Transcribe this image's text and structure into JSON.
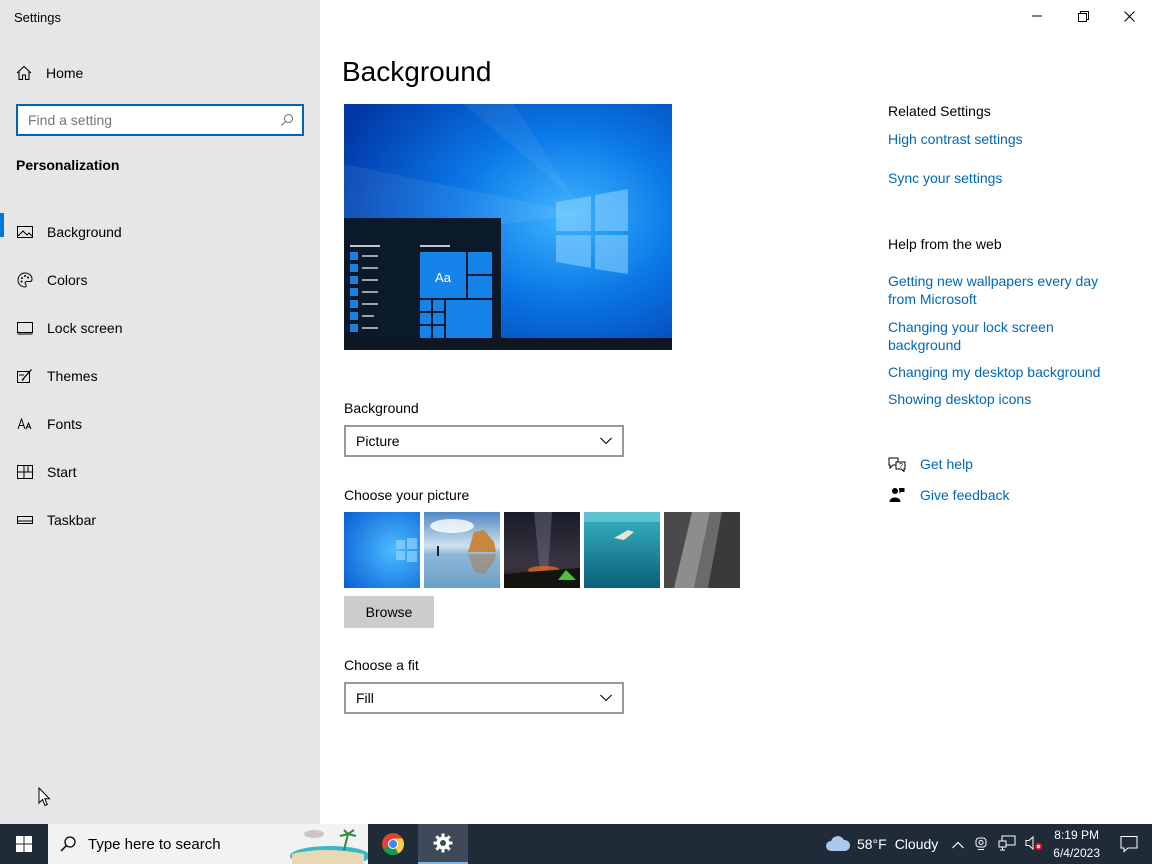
{
  "window": {
    "title": "Settings"
  },
  "sidebar": {
    "home_label": "Home",
    "search_placeholder": "Find a setting",
    "section_title": "Personalization",
    "items": [
      {
        "label": "Background",
        "icon": "picture-icon",
        "active": true
      },
      {
        "label": "Colors",
        "icon": "palette-icon"
      },
      {
        "label": "Lock screen",
        "icon": "lock-screen-icon"
      },
      {
        "label": "Themes",
        "icon": "brush-icon"
      },
      {
        "label": "Fonts",
        "icon": "fonts-icon"
      },
      {
        "label": "Start",
        "icon": "start-icon"
      },
      {
        "label": "Taskbar",
        "icon": "taskbar-icon"
      }
    ]
  },
  "main": {
    "title": "Background",
    "preview": {
      "tile_text": "Aa"
    },
    "background": {
      "label": "Background",
      "value": "Picture"
    },
    "choose_picture": {
      "label": "Choose your picture",
      "thumbnails": [
        "windows-blue",
        "beach-rock",
        "night-sky-tent",
        "underwater-swimmer",
        "rock-cliff"
      ]
    },
    "browse_label": "Browse",
    "fit": {
      "label": "Choose a fit",
      "value": "Fill"
    }
  },
  "right": {
    "related_title": "Related Settings",
    "related_links": [
      "High contrast settings",
      "Sync your settings"
    ],
    "help_title": "Help from the web",
    "help_links": [
      "Getting new wallpapers every day from Microsoft",
      "Changing your lock screen background",
      "Changing my desktop background",
      "Showing desktop icons"
    ],
    "get_help": "Get help",
    "give_feedback": "Give feedback"
  },
  "taskbar": {
    "search_placeholder": "Type here to search",
    "weather": {
      "temp": "58°F",
      "condition": "Cloudy"
    },
    "time": "8:19 PM",
    "date": "6/4/2023"
  },
  "colors": {
    "accent": "#0078d7",
    "link": "#0067b8",
    "sidebar": "#e6e6e6",
    "taskbar": "#202b38"
  }
}
